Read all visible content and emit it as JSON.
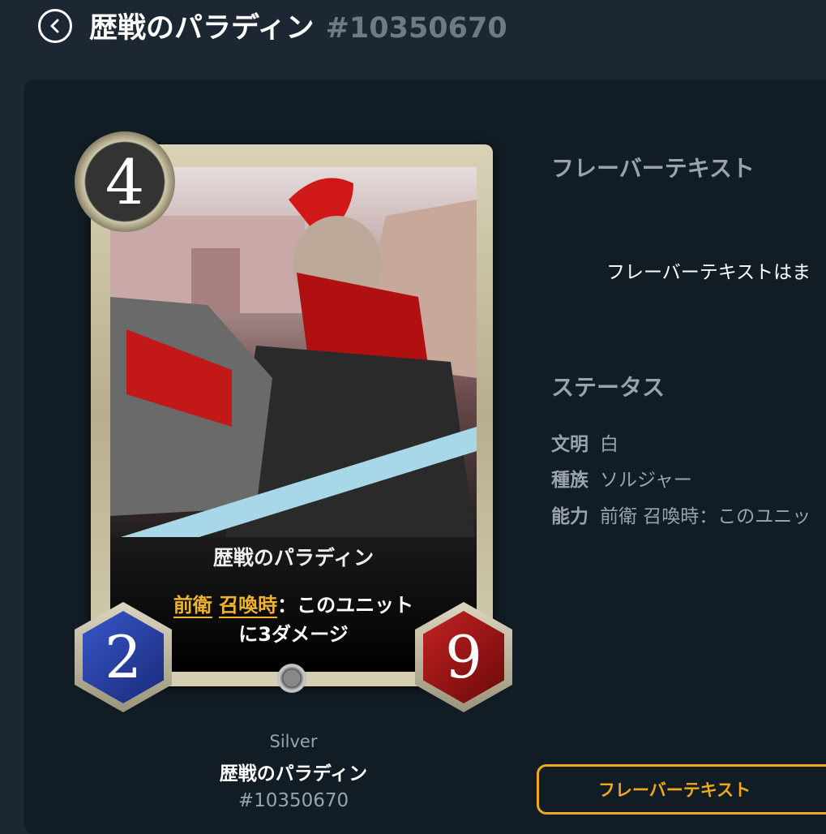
{
  "header": {
    "title": "歴戦のパラディン",
    "id": "#10350670"
  },
  "card": {
    "cost": "4",
    "name": "歴戦のパラディン",
    "ability_kw1": "前衛",
    "ability_kw2": "召喚時",
    "ability_rest1": "：このユニット",
    "ability_line2": "に3ダメージ",
    "attack": "2",
    "defense": "9"
  },
  "under_card": {
    "rarity": "Silver",
    "name": "歴戦のパラディン",
    "id": "#10350670"
  },
  "flavor": {
    "heading": "フレーバーテキスト",
    "body": "フレーバーテキストはま"
  },
  "status": {
    "heading": "ステータス",
    "rows": [
      {
        "key": "文明",
        "value": "白"
      },
      {
        "key": "種族",
        "value": "ソルジャー"
      },
      {
        "key": "能力",
        "value": "前衛 召喚時：このユニッ"
      }
    ]
  },
  "button": {
    "label": "フレーバーテキスト"
  },
  "colors": {
    "accent": "#f0a81c",
    "background": "#1c2733",
    "panel": "#121c24"
  }
}
